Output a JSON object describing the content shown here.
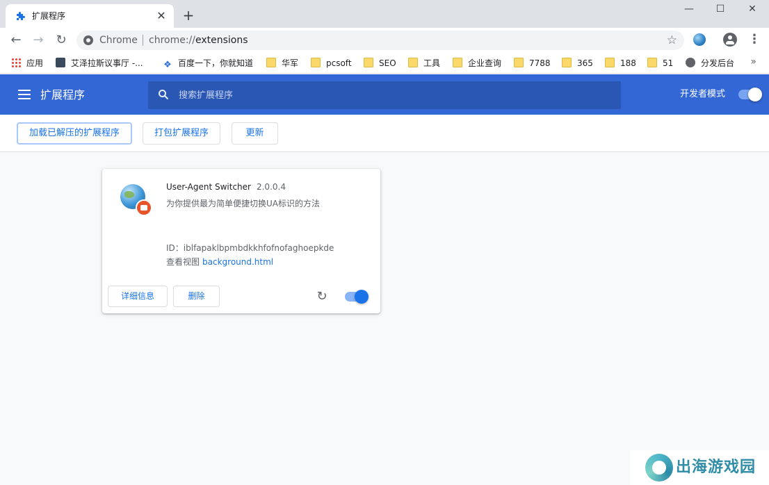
{
  "window": {
    "tab_title": "扩展程序",
    "tab_close": "✕",
    "new_tab": "+",
    "minimize": "—",
    "maximize": "☐",
    "close": "✕"
  },
  "toolbar": {
    "back": "←",
    "forward": "→",
    "reload": "↻",
    "omnibox_label": "Chrome",
    "url_scheme": "chrome://",
    "url_rest": "extensions",
    "star": "☆",
    "menu": "⋮"
  },
  "bookmarks": {
    "items": [
      {
        "label": "应用",
        "icon": "apps-grid-icon"
      },
      {
        "label": "艾泽拉斯议事厅 -...",
        "icon": "site-icon"
      },
      {
        "label": "百度一下，你就知道",
        "icon": "baidu-paw-icon"
      },
      {
        "label": "华军",
        "icon": "folder-icon"
      },
      {
        "label": "pcsoft",
        "icon": "folder-icon"
      },
      {
        "label": "SEO",
        "icon": "folder-icon"
      },
      {
        "label": "工具",
        "icon": "folder-icon"
      },
      {
        "label": "企业查询",
        "icon": "folder-icon"
      },
      {
        "label": "7788",
        "icon": "folder-icon"
      },
      {
        "label": "365",
        "icon": "folder-icon"
      },
      {
        "label": "188",
        "icon": "folder-icon"
      },
      {
        "label": "51",
        "icon": "folder-icon"
      },
      {
        "label": "分发后台",
        "icon": "globe-icon"
      }
    ],
    "more": "»"
  },
  "header": {
    "title": "扩展程序",
    "search_placeholder": "搜索扩展程序",
    "dev_mode_label": "开发者模式",
    "dev_mode_on": true
  },
  "dev_toolbar": {
    "load_unpacked": "加载已解压的扩展程序",
    "pack": "打包扩展程序",
    "update": "更新"
  },
  "extension": {
    "name": "User-Agent Switcher",
    "version": "2.0.0.4",
    "description": "为你提供最为简单便捷切换UA标识的方法",
    "id_text": "ID：iblfapaklbpmbdkkhfofnofaghoepkde",
    "inspect_label": "查看视图",
    "inspect_link": "background.html",
    "details_button": "详细信息",
    "remove_button": "删除",
    "reload_glyph": "↻",
    "enabled": true
  },
  "watermark": {
    "text": "出海游戏园"
  },
  "colors": {
    "header_blue": "#3367d6",
    "link_blue": "#1a73e8",
    "folder_yellow": "#fad86a"
  }
}
